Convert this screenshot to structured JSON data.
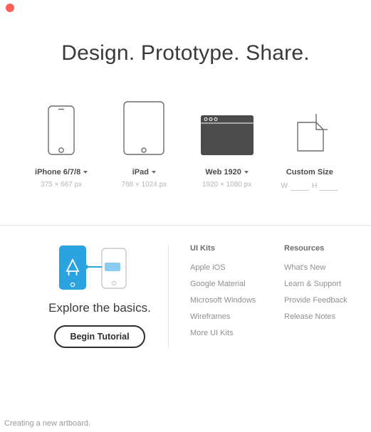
{
  "hero_text": "Design. Prototype. Share.",
  "presets": {
    "phone": {
      "label": "iPhone 6/7/8",
      "dims": "375 × 667 px"
    },
    "tablet": {
      "label": "iPad",
      "dims": "768 × 1024 px"
    },
    "web": {
      "label": "Web 1920",
      "dims": "1920 × 1080 px"
    },
    "custom": {
      "label": "Custom Size",
      "w_prefix": "W",
      "h_prefix": "H"
    }
  },
  "explore": {
    "title": "Explore the basics.",
    "button": "Begin Tutorial"
  },
  "links": {
    "uikits": {
      "title": "UI Kits",
      "items": [
        "Apple iOS",
        "Google Material",
        "Microsoft Windows",
        "Wireframes",
        "More UI Kits"
      ]
    },
    "resources": {
      "title": "Resources",
      "items": [
        "What's New",
        "Learn & Support",
        "Provide Feedback",
        "Release Notes"
      ]
    }
  },
  "caption": "Creating a new artboard."
}
